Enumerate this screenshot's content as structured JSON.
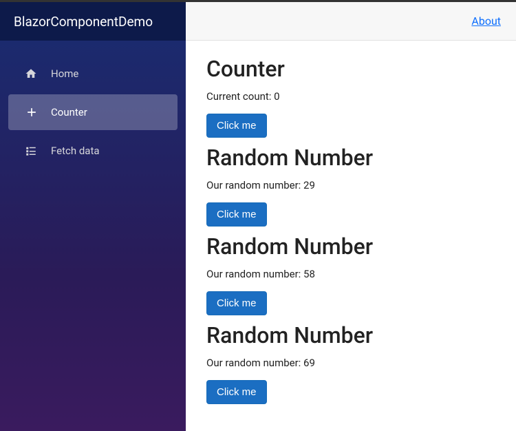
{
  "brand": "BlazorComponentDemo",
  "header": {
    "about_label": "About"
  },
  "sidebar": {
    "items": [
      {
        "label": "Home",
        "icon": "home-icon"
      },
      {
        "label": "Counter",
        "icon": "plus-icon"
      },
      {
        "label": "Fetch data",
        "icon": "list-icon"
      }
    ]
  },
  "main": {
    "counter": {
      "title": "Counter",
      "count_label": "Current count: 0",
      "button_label": "Click me"
    },
    "random_sections": [
      {
        "title": "Random Number",
        "text": "Our random number: 29",
        "button_label": "Click me"
      },
      {
        "title": "Random Number",
        "text": "Our random number: 58",
        "button_label": "Click me"
      },
      {
        "title": "Random Number",
        "text": "Our random number: 69",
        "button_label": "Click me"
      }
    ]
  }
}
